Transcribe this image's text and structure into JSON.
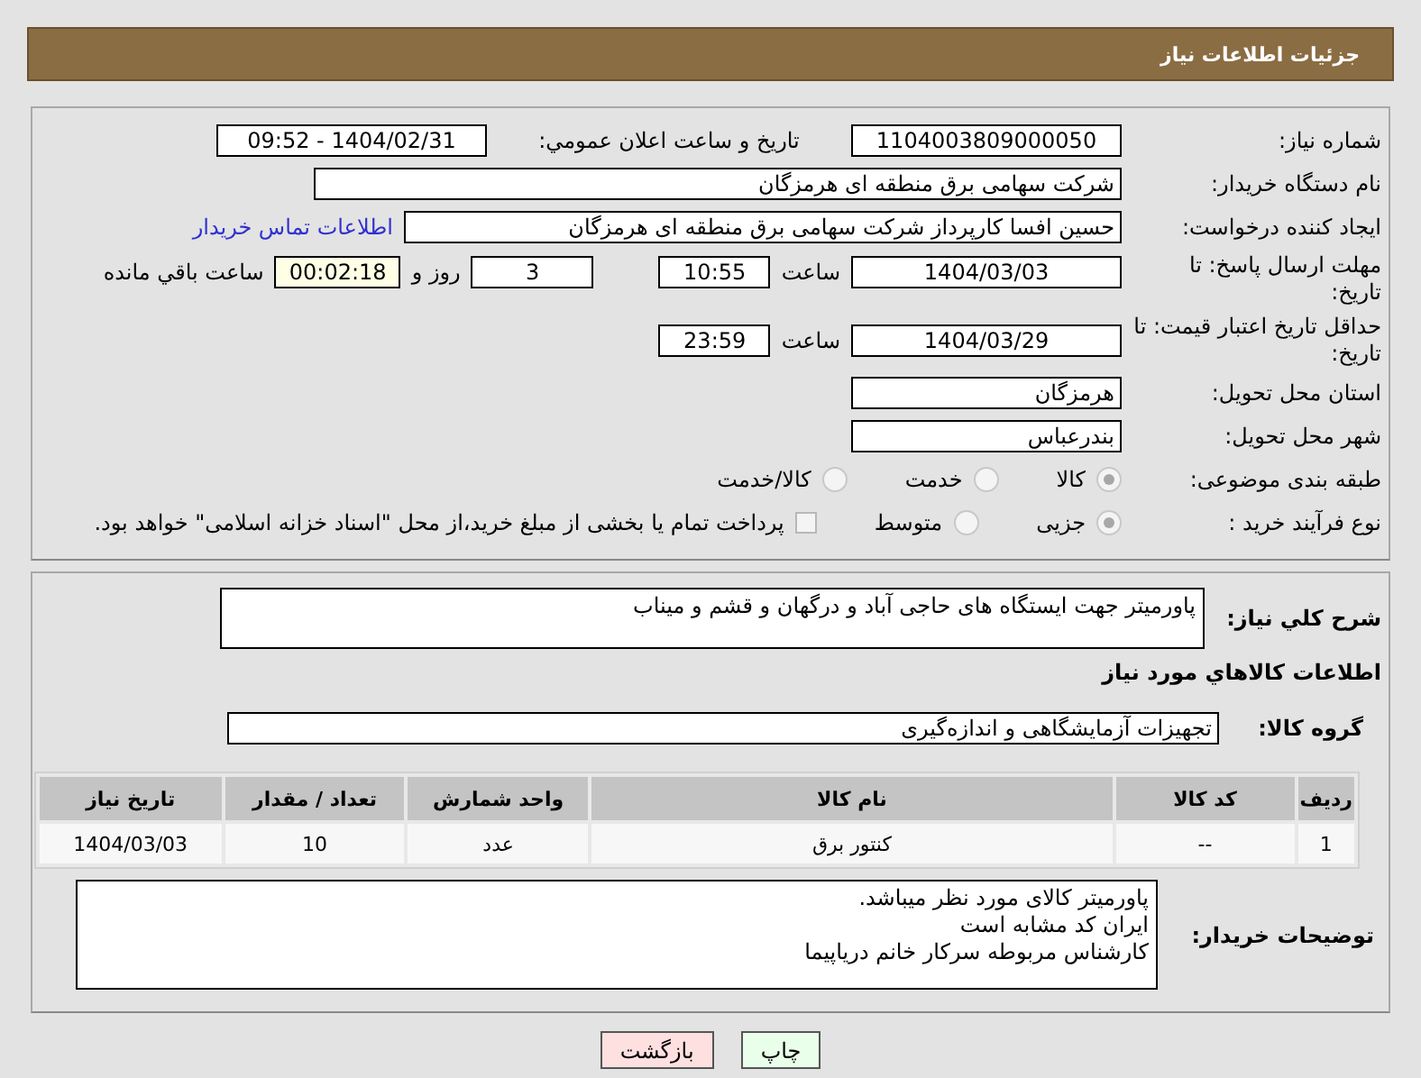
{
  "header": {
    "title": "جزئیات اطلاعات نیاز"
  },
  "need_number": {
    "label": "شماره نیاز:",
    "value": "1104003809000050"
  },
  "announce": {
    "label": "تاریخ و ساعت اعلان عمومي:",
    "value": "1404/02/31 - 09:52"
  },
  "buyer_org": {
    "label": "نام دستگاه خریدار:",
    "value": "شرکت سهامی برق منطقه ای هرمزگان"
  },
  "requester": {
    "label": "ایجاد کننده درخواست:",
    "value": "حسین افسا کارپرداز شرکت سهامی برق منطقه ای هرمزگان",
    "contact_link": "اطلاعات تماس خریدار"
  },
  "response_deadline": {
    "label": "مهلت ارسال پاسخ: تا تاریخ:",
    "date": "1404/03/03",
    "time_label": "ساعت",
    "time": "10:55",
    "days": "3",
    "days_label": "روز و",
    "remaining": "00:02:18",
    "remaining_label": "ساعت باقي مانده"
  },
  "price_validity": {
    "label": "حداقل تاریخ اعتبار قیمت: تا تاریخ:",
    "date": "1404/03/29",
    "time_label": "ساعت",
    "time": "23:59"
  },
  "province": {
    "label": "استان محل تحویل:",
    "value": "هرمزگان"
  },
  "city": {
    "label": "شهر محل تحویل:",
    "value": "بندرعباس"
  },
  "category": {
    "label": "طبقه بندی موضوعی:",
    "options": [
      {
        "label": "کالا",
        "selected": true
      },
      {
        "label": "خدمت",
        "selected": false
      },
      {
        "label": "کالا/خدمت",
        "selected": false
      }
    ]
  },
  "process": {
    "label": "نوع فرآیند خرید :",
    "options": [
      {
        "label": "جزیی",
        "selected": true
      },
      {
        "label": "متوسط",
        "selected": false
      }
    ],
    "payment_checkbox": {
      "label": "پرداخت تمام یا بخشی از مبلغ خرید،از محل \"اسناد خزانه اسلامی\" خواهد بود.",
      "checked": false
    }
  },
  "description": {
    "label": "شرح کلي نیاز:",
    "value": "پاورمیتر جهت ایستگاه های حاجی آباد  و درگهان و قشم و میناب"
  },
  "goods_title": "اطلاعات کالاهاي مورد نیاز",
  "goods_group": {
    "label": "گروه کالا:",
    "value": "تجهیزات آزمایشگاهی و اندازه‌گیری"
  },
  "table": {
    "columns": [
      "ردیف",
      "کد کالا",
      "نام کالا",
      "واحد شمارش",
      "تعداد / مقدار",
      "تاریخ نیاز"
    ],
    "rows": [
      [
        "1",
        "--",
        "کنتور برق",
        "عدد",
        "10",
        "1404/03/03"
      ]
    ]
  },
  "buyer_notes": {
    "label": "توضیحات خریدار:",
    "lines": [
      "پاورمیتر کالای مورد نظر میباشد.",
      "ایران کد مشابه است",
      "کارشناس مربوطه سرکار خانم دریاپیما"
    ]
  },
  "buttons": [
    {
      "label": "چاپ",
      "kind": "print"
    },
    {
      "label": "بازگشت",
      "kind": "back"
    }
  ]
}
